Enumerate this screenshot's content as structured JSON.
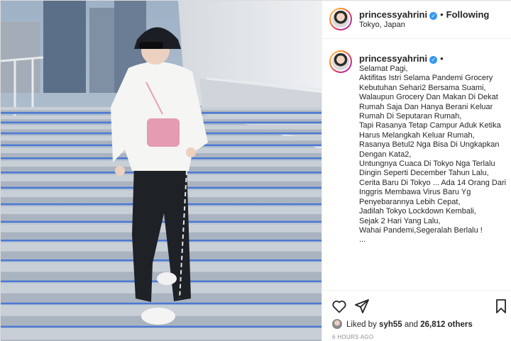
{
  "header": {
    "username": "princessyahrini",
    "separator": "•",
    "follow_label": "Following",
    "location": "Tokyo, Japan"
  },
  "caption": {
    "username": "princessyahrini",
    "separator": "•",
    "text": "Selamat Pagi,\nAktifitas Istri Selama Pandemi Grocery Kebutuhan Sehari2 Bersama Suami,\nWalaupun Grocery Dan Makan Di Dekat Rumah Saja Dan Hanya Berani Keluar Rumah Di Seputaran Rumah,\nTapi Rasanya Tetap Campur Aduk Ketika Harus Melangkah Keluar Rumah,\nRasanya Betul2 Nga Bisa Di Ungkapkan Dengan Kata2,\nUntungnya Cuaca Di Tokyo Nga Terlalu Dingin Seperti December Tahun Lalu,\nCerita Baru Di Tokyo ... Ada 14 Orang Dari Inggris Membawa Virus Baru Yg Penyebarannya Lebih Cepat,\nJadilah Tokyo Lockdown Kembali,\nSejak 2 Hari Yang Lalu,\nWahai Pandemi,Segeralah Berlalu !\n..."
  },
  "likes": {
    "prefix": "Liked by",
    "user": "syh55",
    "middle": "and",
    "others": "26,812 others"
  },
  "timestamp": "6 HOURS AGO",
  "icons": {
    "like": "heart-icon",
    "share": "paper-plane-icon",
    "save": "bookmark-icon",
    "verified": "verified-badge-icon"
  },
  "colors": {
    "text": "#262626",
    "muted": "#8e8e8e",
    "verified": "#3897f0",
    "border": "#dbdbdb"
  }
}
